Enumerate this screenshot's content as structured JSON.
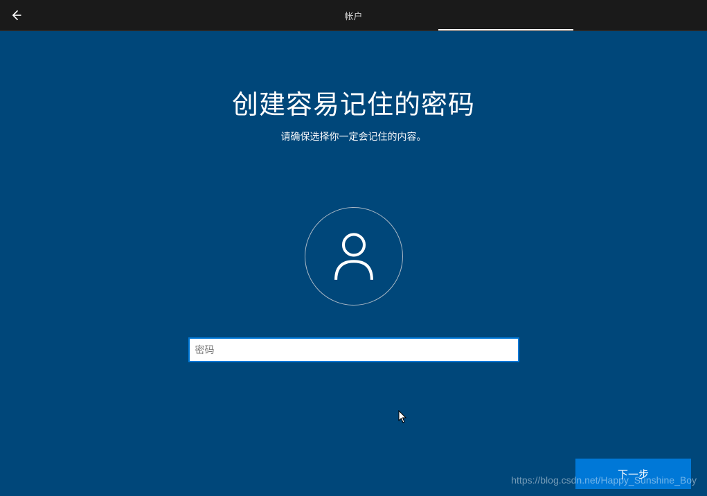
{
  "header": {
    "title": "帐户"
  },
  "page": {
    "title": "创建容易记住的密码",
    "subtitle": "请确保选择你一定会记住的内容。"
  },
  "password": {
    "placeholder": "密码",
    "value": ""
  },
  "next_button": {
    "label": "下一步"
  },
  "watermark": "https://blog.csdn.net/Happy_Sunshine_Boy"
}
